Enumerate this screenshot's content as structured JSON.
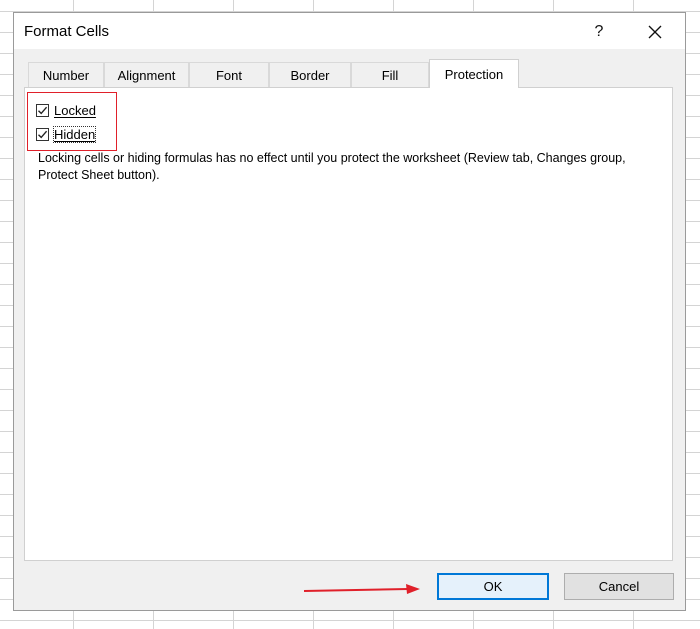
{
  "dialog": {
    "title": "Format Cells",
    "help_label": "?",
    "close_icon": "close-icon"
  },
  "tabs": [
    {
      "label": "Number",
      "active": false
    },
    {
      "label": "Alignment",
      "active": false
    },
    {
      "label": "Font",
      "active": false
    },
    {
      "label": "Border",
      "active": false
    },
    {
      "label": "Fill",
      "active": false
    },
    {
      "label": "Protection",
      "active": true
    }
  ],
  "protection": {
    "locked_label": "Locked",
    "locked_checked": true,
    "hidden_label": "Hidden",
    "hidden_checked": true,
    "note": "Locking cells or hiding formulas has no effect until you protect the worksheet (Review tab, Changes group, Protect Sheet button)."
  },
  "buttons": {
    "ok_label": "OK",
    "cancel_label": "Cancel"
  },
  "annotations": {
    "highlight_color": "#e0202a",
    "arrow_color": "#e0202a"
  },
  "colors": {
    "accent": "#0078d7",
    "dialog_bg": "#f0f0f0",
    "panel_bg": "#ffffff"
  }
}
